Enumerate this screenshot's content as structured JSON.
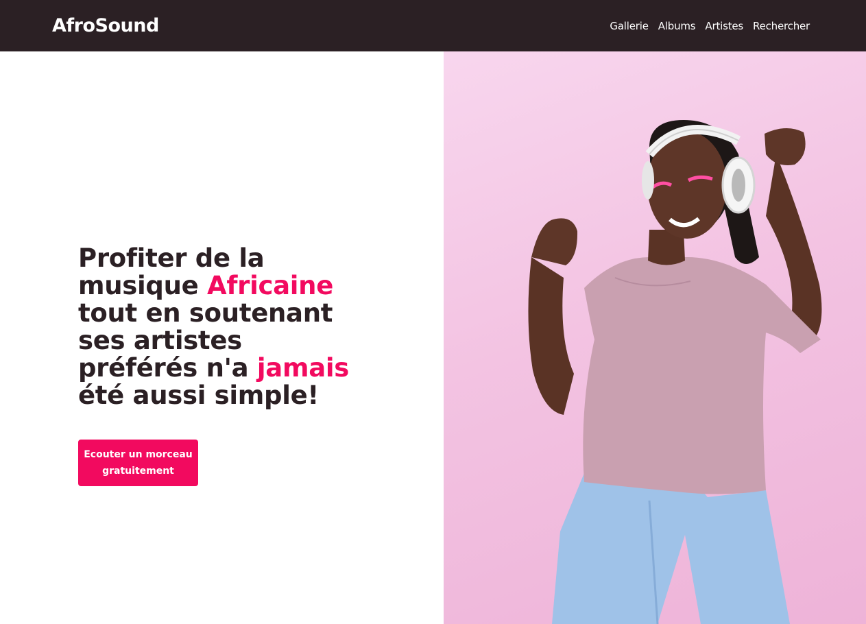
{
  "brand": {
    "name": "AfroSound"
  },
  "nav": {
    "items": [
      {
        "label": "Gallerie"
      },
      {
        "label": "Albums"
      },
      {
        "label": "Artistes"
      },
      {
        "label": "Rechercher"
      }
    ]
  },
  "hero": {
    "headline": {
      "p1": "Profiter de la musique ",
      "accent1": "Africaine",
      "p2": " tout en soutenant ses artistes préférés n'a ",
      "accent2": "jamais",
      "p3": " été aussi simple!"
    },
    "cta": {
      "line1": "Ecouter un morceau",
      "line2": "gratuitement"
    }
  },
  "colors": {
    "navbar_bg": "#2b2024",
    "accent": "#f20a5f",
    "text_dark": "#2b2024",
    "photo_bg": "#f3c3e2"
  }
}
